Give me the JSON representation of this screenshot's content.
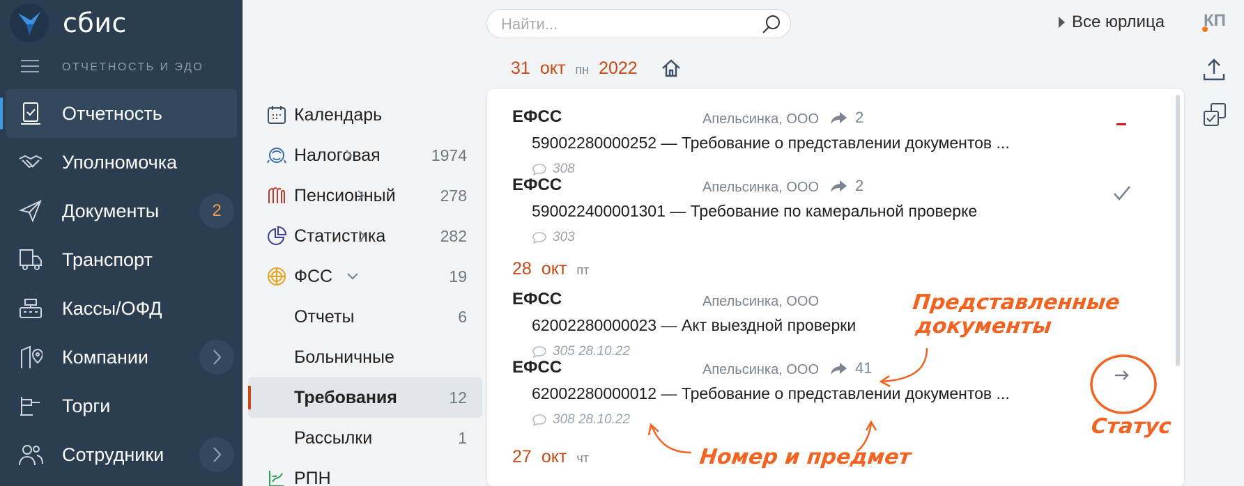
{
  "app": {
    "logo_text": "сбис",
    "section_title": "ОТЧЕТНОСТЬ И ЭДО"
  },
  "sidebar": {
    "items": [
      {
        "label": "Отчетность",
        "icon": "report-icon",
        "active": true
      },
      {
        "label": "Уполномочка",
        "icon": "handshake-icon"
      },
      {
        "label": "Документы",
        "icon": "paper-plane-icon",
        "badge": "2"
      },
      {
        "label": "Транспорт",
        "icon": "truck-icon"
      },
      {
        "label": "Кассы/ОФД",
        "icon": "cash-register-icon"
      },
      {
        "label": "Компании",
        "icon": "building-pin-icon",
        "chevron": true
      },
      {
        "label": "Торги",
        "icon": "gavel-icon"
      },
      {
        "label": "Сотрудники",
        "icon": "people-icon",
        "chevron": true
      }
    ]
  },
  "search": {
    "placeholder": "Найти..."
  },
  "org_selector": {
    "label": "Все юрлица"
  },
  "user": {
    "initials": "КП"
  },
  "date_header": {
    "day": "31",
    "month": "окт",
    "weekday": "пн",
    "year": "2022"
  },
  "subnav": {
    "items": [
      {
        "label": "Календарь",
        "icon": "calendar-icon"
      },
      {
        "label": "Налоговая",
        "icon": "tax-icon",
        "count": "1974",
        "chevron": "right"
      },
      {
        "label": "Пенсионный",
        "icon": "pension-icon",
        "count": "278",
        "chevron": "right"
      },
      {
        "label": "Статистика",
        "icon": "pie-chart-icon",
        "count": "282",
        "chevron": "right"
      },
      {
        "label": "ФСС",
        "icon": "fss-icon",
        "count": "19",
        "chevron": "down"
      },
      {
        "label": "Отчеты",
        "count": "6",
        "child": true
      },
      {
        "label": "Больничные",
        "child": true
      },
      {
        "label": "Требования",
        "count": "12",
        "child": true,
        "selected": true
      },
      {
        "label": "Рассылки",
        "count": "1",
        "child": true
      },
      {
        "label": "РПН",
        "icon": "rpn-icon"
      }
    ]
  },
  "groups": [
    {
      "date": null,
      "rows": [
        {
          "sender": "ЕФСС",
          "company": "Апельсинка, ООО",
          "shared": "2",
          "title": "59002280000252 — Требование о представлении документов ...",
          "comment": "308",
          "status": "minus"
        },
        {
          "sender": "ЕФСС",
          "company": "Апельсинка, ООО",
          "shared": "2",
          "title": "590022400001301 — Требование по камеральной проверке",
          "comment": "303",
          "status": "check"
        }
      ]
    },
    {
      "date": {
        "day": "28",
        "month": "окт",
        "weekday": "пт"
      },
      "rows": [
        {
          "sender": "ЕФСС",
          "company": "Апельсинка, ООО",
          "title": "62002280000023 — Акт выездной проверки",
          "comment": "305 28.10.22"
        },
        {
          "sender": "ЕФСС",
          "company": "Апельсинка, ООО",
          "shared": "41",
          "title": "62002280000012 — Требование о представлении документов ...",
          "comment": "308 28.10.22",
          "status": "arrow"
        }
      ]
    },
    {
      "date": {
        "day": "27",
        "month": "окт",
        "weekday": "чт"
      },
      "rows": []
    }
  ],
  "annotations": {
    "submitted_docs": "Представленные документы",
    "status": "Статус",
    "number_subject": "Номер и предмет"
  },
  "colors": {
    "sidebar_bg": "#2b3d51",
    "accent_red": "#c94a17",
    "annotation_orange": "#f26322",
    "active_marker": "#3d9be9"
  }
}
